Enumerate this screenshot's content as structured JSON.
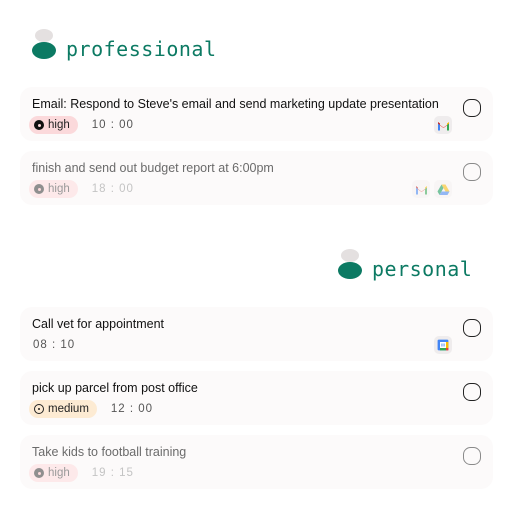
{
  "sections": [
    {
      "title": "professional",
      "tasks": [
        {
          "title": "Email: Respond to Steve's email and send marketing update presentation",
          "priority": "high",
          "time": "10 : 00",
          "apps": [
            "gmail-icon"
          ],
          "completed": false,
          "faded": false
        },
        {
          "title": "finish and send out budget report at 6:00pm",
          "priority": "high",
          "time": "18 : 00",
          "apps": [
            "gmail-icon",
            "google-drive-icon"
          ],
          "completed": false,
          "faded": true
        }
      ]
    },
    {
      "title": "personal",
      "tasks": [
        {
          "title": "Call vet for appointment",
          "priority": null,
          "time": "08 : 10",
          "apps": [
            "google-calendar-icon"
          ],
          "completed": false,
          "faded": false
        },
        {
          "title": "pick up parcel from post office",
          "priority": "medium",
          "time": "12 : 00",
          "apps": [],
          "completed": false,
          "faded": false
        },
        {
          "title": "Take kids to football training",
          "priority": "high",
          "time": "19 : 15",
          "apps": [],
          "completed": false,
          "faded": true
        }
      ]
    }
  ],
  "colors": {
    "brand": "#0c7a63",
    "logo_top": "#e4e0e0",
    "card_bg": "#fcfafa",
    "high_badge": "#fbd9db",
    "medium_badge": "#fdebd3"
  }
}
